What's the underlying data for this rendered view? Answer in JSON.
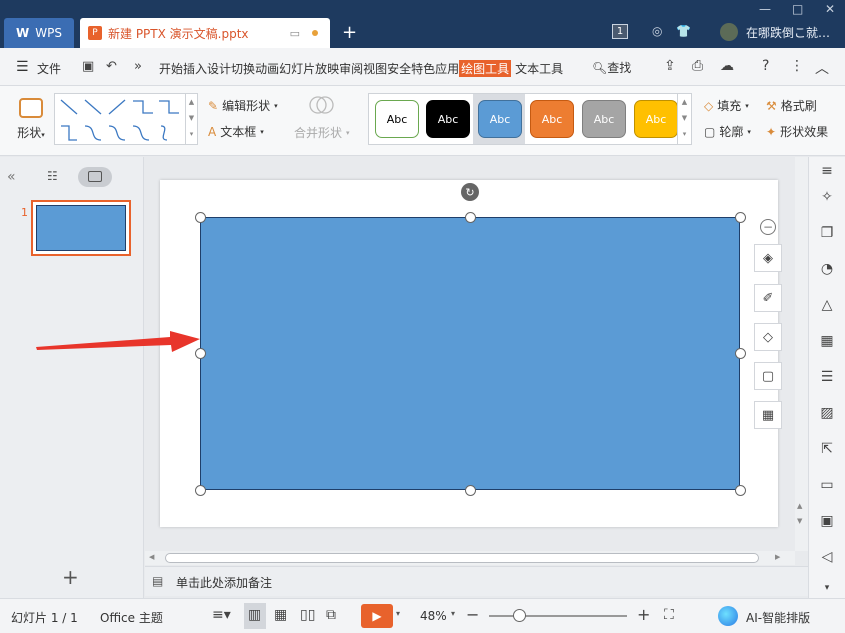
{
  "titlebar": {
    "app_tab": "WPS",
    "doc_tab": "新建 PPTX 演示文稿.pptx",
    "new_tab": "+",
    "badge_count": "1",
    "username": "在哪跌倒こ就…",
    "win_minimize": "—",
    "win_restore": "□",
    "win_close": "✕"
  },
  "menubar": {
    "file": "文件",
    "more": "»",
    "items": [
      "开始",
      "插入",
      "设计",
      "切换",
      "动画",
      "幻灯片放映",
      "审阅",
      "视图",
      "安全",
      "特色应用",
      "绘图工具",
      "文本工具"
    ],
    "active_item": "绘图工具",
    "search": "查找"
  },
  "ribbon": {
    "shape_label": "形状",
    "edit_shape": "编辑形状",
    "text_box": "文本框",
    "merge_shape": "合并形状",
    "style_text": "Abc",
    "styles": [
      {
        "bg": "#ffffff",
        "border": "#6aa84f",
        "fg": "#000000"
      },
      {
        "bg": "#000000",
        "border": "#000000",
        "fg": "#ffffff"
      },
      {
        "bg": "#5b9bd5",
        "border": "#41719c",
        "fg": "#ffffff"
      },
      {
        "bg": "#ed7d31",
        "border": "#c55a11",
        "fg": "#ffffff"
      },
      {
        "bg": "#a5a5a5",
        "border": "#7f7f7f",
        "fg": "#ffffff"
      },
      {
        "bg": "#ffc000",
        "border": "#bf9000",
        "fg": "#ffffff"
      }
    ],
    "fill": "填充",
    "format_painter": "格式刷",
    "outline": "轮廓",
    "shape_effects": "形状效果"
  },
  "leftpanel": {
    "slide_number": "1",
    "add": "+"
  },
  "slide": {
    "shape_fill": "#5b9bd5"
  },
  "notes": {
    "placeholder": "单击此处添加备注"
  },
  "statusbar": {
    "slide_info": "幻灯片 1 / 1",
    "theme": "Office 主题",
    "zoom": "48%",
    "zoom_level_percent": 48,
    "ai_layout": "AI-智能排版"
  }
}
